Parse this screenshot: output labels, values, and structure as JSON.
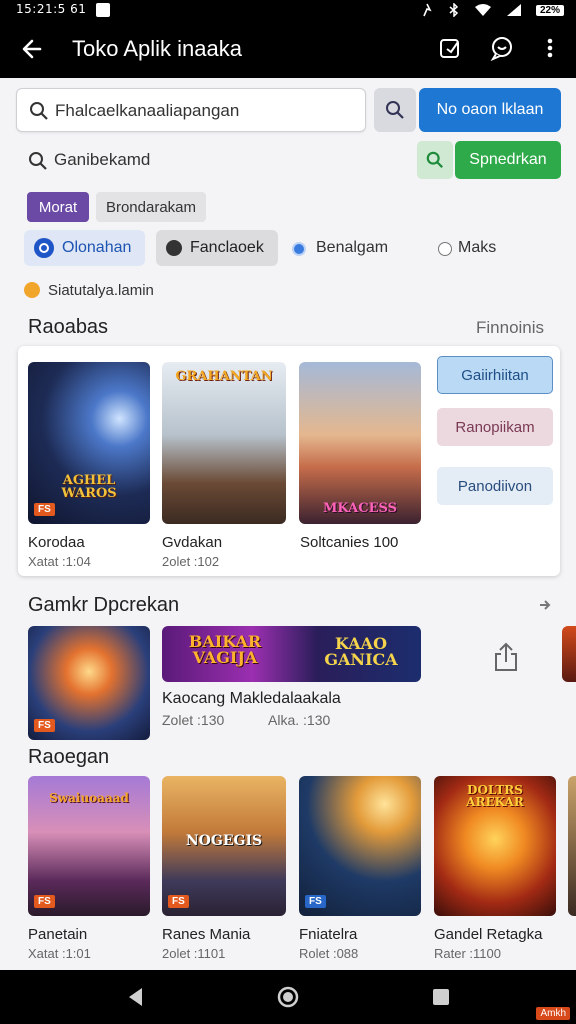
{
  "status_bar": {
    "time": "15:21:5 61",
    "battery": "22%"
  },
  "app_bar": {
    "title": "Toko Aplik inaaka"
  },
  "search": {
    "primary_placeholder": "Fhalcaelkanaaliapangan",
    "primary_button": "No oaon lklaan",
    "secondary_placeholder": "Ganibekamd",
    "secondary_button": "Spnedrkan"
  },
  "chips": [
    "Morat",
    "Brondarakam"
  ],
  "radio_options": [
    "Olonahan",
    "Fanclaoek",
    "Benalgam",
    "Maks"
  ],
  "info_text": "Siatutalya.lamin",
  "featured": {
    "title": "Raoabas",
    "link": "Finnoinis",
    "cards": [
      {
        "art": "AGHEL WAROS",
        "name": "Korodaa",
        "sub": "Xatat :1:04",
        "badge": "FS"
      },
      {
        "art": "GRAHANTAN",
        "name": "Gvdakan",
        "sub": "2olet :102",
        "badge": ""
      },
      {
        "art": "MKACESS",
        "name": "Soltcanies 100",
        "sub": "",
        "badge": ""
      }
    ],
    "side_buttons": [
      "Gaiirhiitan",
      "Ranopiikam",
      "Panodiivon"
    ]
  },
  "promo": {
    "title": "Gamkr Dpcrekan",
    "banner_left": "BAIKAR VAGIJA",
    "banner_right": "KAAO GANICA",
    "name": "Kaocang Makledalaakala",
    "sub_left": "Zolet :130",
    "sub_right": "Alka. :130",
    "badge": "FS"
  },
  "recommended": {
    "title": "Raoegan",
    "cards": [
      {
        "art": "Swaiuoaaad",
        "name": "Panetain",
        "sub": "Xatat :1:01",
        "badge": "FS"
      },
      {
        "art": "NOGEGIS",
        "name": "Ranes Mania",
        "sub": "2olet :1101",
        "badge": "FS"
      },
      {
        "art": "",
        "name": "Fniatelra",
        "sub": "Rolet :088",
        "badge": "FS"
      },
      {
        "art": "DOLTRS AREKAR",
        "name": "Gandel Retagka",
        "sub": "Rater :1100",
        "badge": ""
      }
    ]
  },
  "nav": {
    "corner_badge": "Amkh"
  },
  "colors": {
    "accent_blue": "#1e77d3",
    "accent_green": "#2faa4a",
    "chip_purple": "#6b4aa5"
  }
}
